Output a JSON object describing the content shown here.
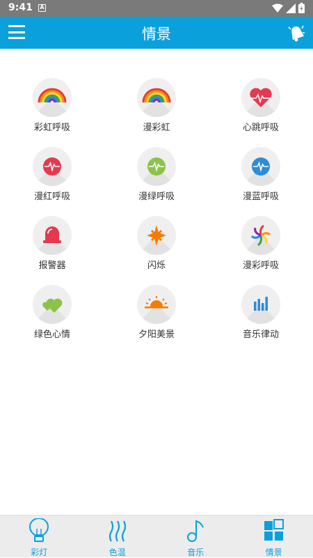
{
  "status_bar": {
    "time": "9:41",
    "notification_letter": "A"
  },
  "app_bar": {
    "title": "情景"
  },
  "scenes": [
    {
      "label": "彩虹呼吸",
      "icon": "rainbow-icon"
    },
    {
      "label": "漫彩虹",
      "icon": "rainbow-icon"
    },
    {
      "label": "心跳呼吸",
      "icon": "heartbeat-icon"
    },
    {
      "label": "漫红呼吸",
      "icon": "red-pulse-icon"
    },
    {
      "label": "漫绿呼吸",
      "icon": "green-pulse-icon"
    },
    {
      "label": "漫蓝呼吸",
      "icon": "blue-pulse-icon"
    },
    {
      "label": "报警器",
      "icon": "siren-icon"
    },
    {
      "label": "闪烁",
      "icon": "flash-icon"
    },
    {
      "label": "漫彩呼吸",
      "icon": "color-spiral-icon"
    },
    {
      "label": "绿色心情",
      "icon": "green-hearts-icon"
    },
    {
      "label": "夕阳美景",
      "icon": "sunset-icon"
    },
    {
      "label": "音乐律动",
      "icon": "music-bars-icon"
    }
  ],
  "tabs": [
    {
      "label": "彩灯",
      "icon": "bulb-icon"
    },
    {
      "label": "色温",
      "icon": "heat-waves-icon"
    },
    {
      "label": "音乐",
      "icon": "music-note-icon"
    },
    {
      "label": "情景",
      "icon": "grid-icon"
    }
  ],
  "colors": {
    "accent": "#0aa0dc",
    "tab_label": "#0aa0dc",
    "icon_bg": "#efefef"
  }
}
